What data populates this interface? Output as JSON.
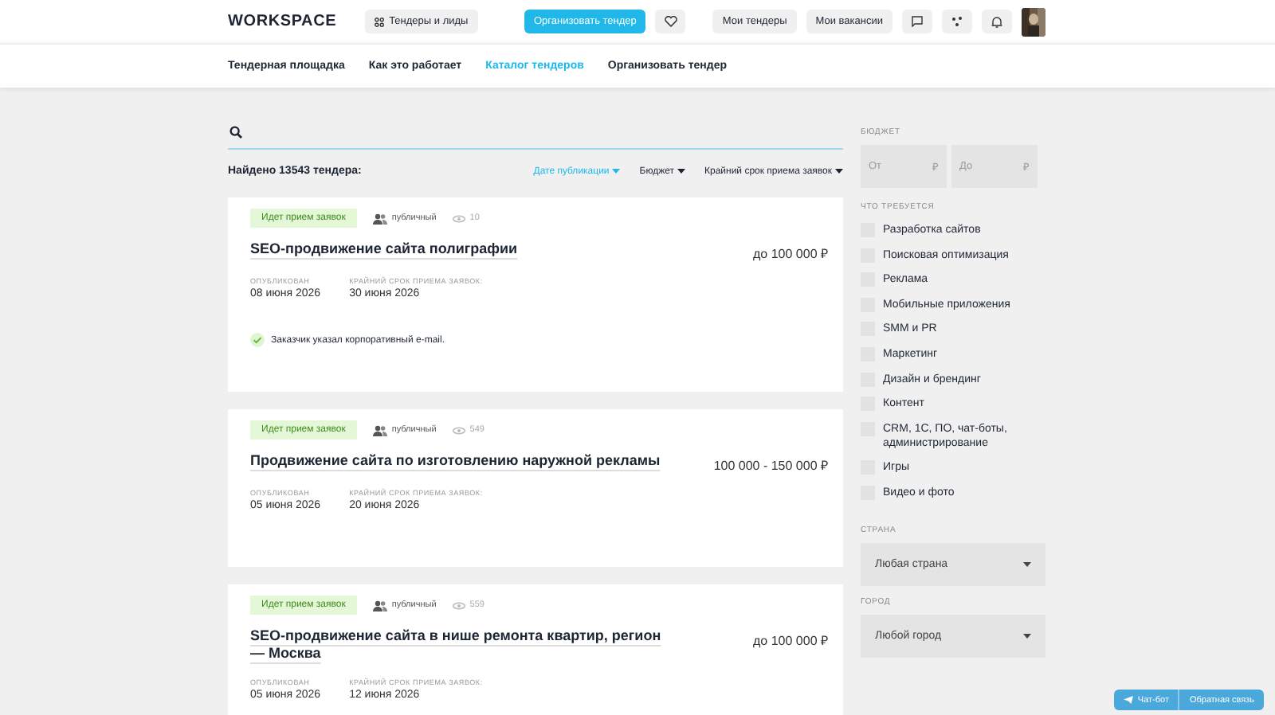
{
  "header": {
    "logo": "WORKSPACE",
    "menu_button": "Тендеры и лиды",
    "primary_button": "Организовать тендер",
    "buttons": [
      "Мои тендеры",
      "Мои вакансии"
    ]
  },
  "nav": [
    {
      "label": "Тендерная площадка",
      "selected": false
    },
    {
      "label": "Как это работает",
      "selected": false
    },
    {
      "label": "Каталог тендеров",
      "selected": true
    },
    {
      "label": "Организовать тендер",
      "selected": false
    }
  ],
  "found": "Найдено 13543 тендера:",
  "sort": [
    {
      "label": "Дате публикации",
      "selected": true
    },
    {
      "label": "Бюджет",
      "selected": false
    },
    {
      "label": "Крайний срок приема заявок",
      "selected": false
    }
  ],
  "tenders": [
    {
      "status": "Идет прием заявок",
      "access": "публичный",
      "views": "10",
      "title": "SEO-продвижение сайта полиграфии",
      "price": "до 100 000 ₽",
      "published_label": "ОПУБЛИКОВАН",
      "published": "08 июня 2026",
      "deadline_label": "КРАЙНИЙ СРОК ПРИЕМА ЗАЯВОК:",
      "deadline": "30 июня 2026",
      "note": "Заказчик указал корпоративный e-mail."
    },
    {
      "status": "Идет прием заявок",
      "access": "публичный",
      "views": "549",
      "title": "Продвижение сайта по изготовлению наружной рекламы",
      "price": "100 000 - 150 000 ₽",
      "published_label": "ОПУБЛИКОВАН",
      "published": "05 июня 2026",
      "deadline_label": "КРАЙНИЙ СРОК ПРИЕМА ЗАЯВОК:",
      "deadline": "20 июня 2026"
    },
    {
      "status": "Идет прием заявок",
      "access": "публичный",
      "views": "559",
      "title": "SEO-продвижение сайта в нише ремонта квартир, регион — Москва",
      "price": "до 100 000 ₽",
      "published_label": "ОПУБЛИКОВАН",
      "published": "05 июня 2026",
      "deadline_label": "КРАЙНИЙ СРОК ПРИЕМА ЗАЯВОК:",
      "deadline": "12 июня 2026"
    }
  ],
  "filters": {
    "budget_label": "БЮДЖЕТ",
    "budget_from": {
      "placeholder": "От",
      "currency": "₽"
    },
    "budget_to": {
      "placeholder": "До",
      "currency": "₽"
    },
    "needs_label": "ЧТО ТРЕБУЕТСЯ",
    "needs": [
      {
        "label": "Разработка сайтов",
        "checked": false
      },
      {
        "label": "Поисковая оптимизация",
        "checked": false
      },
      {
        "label": "Реклама",
        "checked": false
      },
      {
        "label": "Мобильные приложения",
        "checked": false
      },
      {
        "label": "SMM и PR",
        "checked": false
      },
      {
        "label": "Маркетинг",
        "checked": false
      },
      {
        "label": "Дизайн и брендинг",
        "checked": false
      },
      {
        "label": "Контент",
        "checked": false
      },
      {
        "label": "CRM, 1С, ПО, чат-боты, администрирование",
        "checked": false
      },
      {
        "label": "Игры",
        "checked": false
      },
      {
        "label": "Видео и фото",
        "checked": false
      }
    ],
    "country_label": "СТРАНА",
    "country": "Любая страна",
    "city_label": "ГОРОД",
    "city": "Любой город"
  },
  "floating": {
    "chatbot": "Чат-бот",
    "feedback": "Обратная связь"
  }
}
